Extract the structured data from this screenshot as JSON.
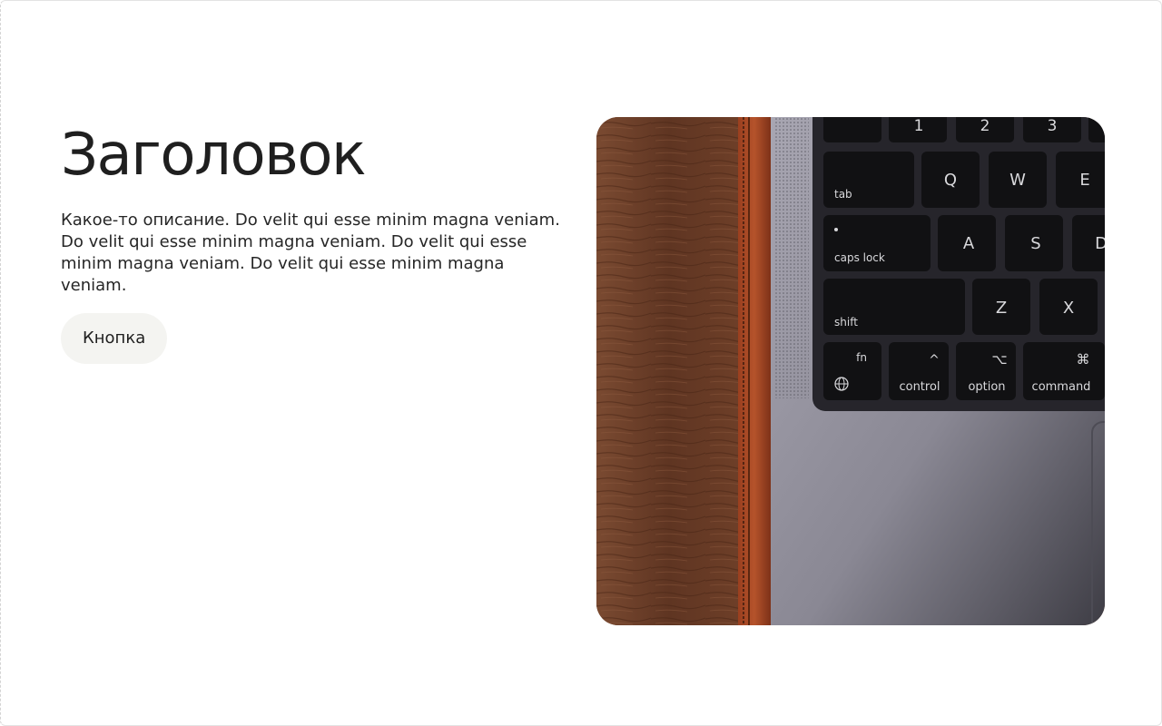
{
  "hero": {
    "title": "Заголовок",
    "description": "Какое-то описание. Do velit qui esse minim magna veniam. Do velit qui esse minim magna veniam. Do velit qui esse minim magna veniam. Do velit qui esse minim magna veniam.",
    "button_label": "Кнопка"
  },
  "keyboard": {
    "row1": [
      "1",
      "2",
      "3"
    ],
    "tab": "tab",
    "row2": [
      "Q",
      "W",
      "E"
    ],
    "caps": "caps lock",
    "row3": [
      "A",
      "S",
      "D"
    ],
    "shift": "shift",
    "row4": [
      "Z",
      "X"
    ],
    "fn": "fn",
    "control": "control",
    "control_symbol": "^",
    "option": "option",
    "option_symbol": "⌥",
    "command": "command",
    "command_symbol": "⌘",
    "globe_symbol": "🌐"
  },
  "colors": {
    "button_bg": "#f4f4f1",
    "text": "#1f1f1f",
    "wood": "#6b3b22",
    "laptop": "#8f8d97",
    "key": "#111113"
  }
}
